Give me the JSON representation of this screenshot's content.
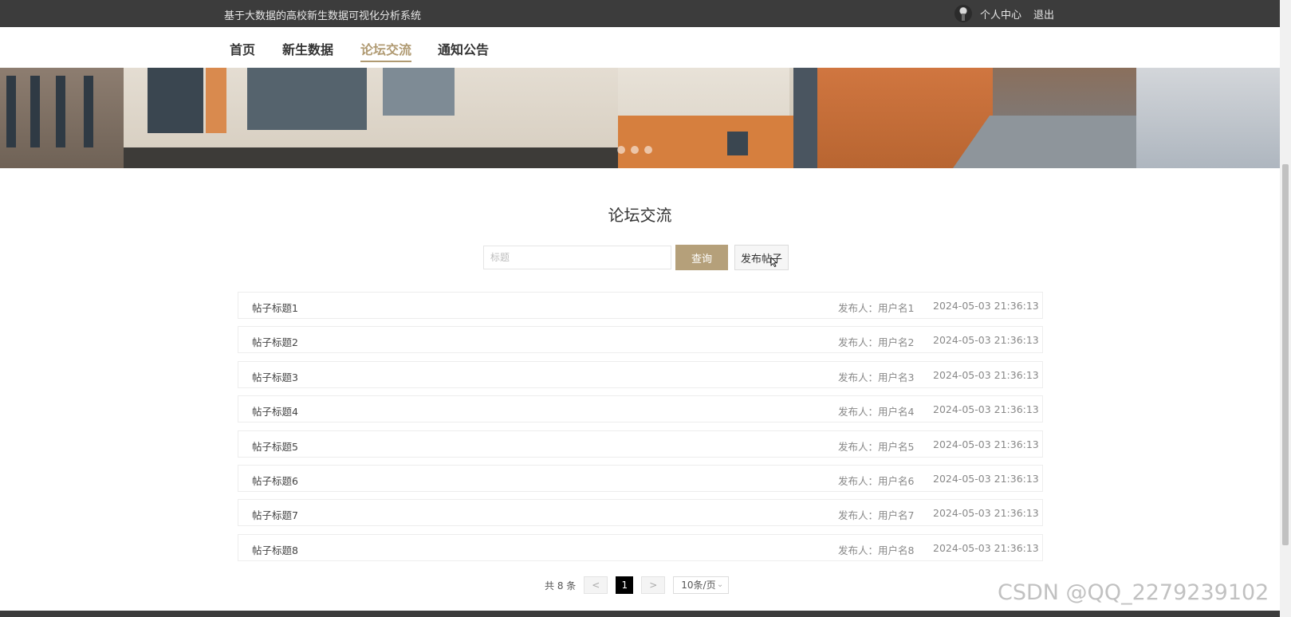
{
  "topbar": {
    "site_title": "基于大数据的高校新生数据可视化分析系统",
    "profile_label": "个人中心",
    "logout_label": "退出"
  },
  "nav": {
    "items": [
      {
        "label": "首页"
      },
      {
        "label": "新生数据"
      },
      {
        "label": "论坛交流",
        "active": true
      },
      {
        "label": "通知公告"
      }
    ]
  },
  "page": {
    "heading": "论坛交流",
    "search_placeholder": "标题",
    "query_label": "查询",
    "post_label": "发布帖子"
  },
  "posts": [
    {
      "title": "帖子标题1",
      "author": "发布人：用户名1",
      "time": "2024-05-03 21:36:13"
    },
    {
      "title": "帖子标题2",
      "author": "发布人：用户名2",
      "time": "2024-05-03 21:36:13"
    },
    {
      "title": "帖子标题3",
      "author": "发布人：用户名3",
      "time": "2024-05-03 21:36:13"
    },
    {
      "title": "帖子标题4",
      "author": "发布人：用户名4",
      "time": "2024-05-03 21:36:13"
    },
    {
      "title": "帖子标题5",
      "author": "发布人：用户名5",
      "time": "2024-05-03 21:36:13"
    },
    {
      "title": "帖子标题6",
      "author": "发布人：用户名6",
      "time": "2024-05-03 21:36:13"
    },
    {
      "title": "帖子标题7",
      "author": "发布人：用户名7",
      "time": "2024-05-03 21:36:13"
    },
    {
      "title": "帖子标题8",
      "author": "发布人：用户名8",
      "time": "2024-05-03 21:36:13"
    }
  ],
  "pagination": {
    "total": "共 8 条",
    "prev": "<",
    "current": "1",
    "next": ">",
    "page_size": "10条/页"
  },
  "watermark": "CSDN @QQ_2279239102",
  "colors": {
    "accent": "#b5a07a",
    "topbar": "#3c3c3c"
  }
}
